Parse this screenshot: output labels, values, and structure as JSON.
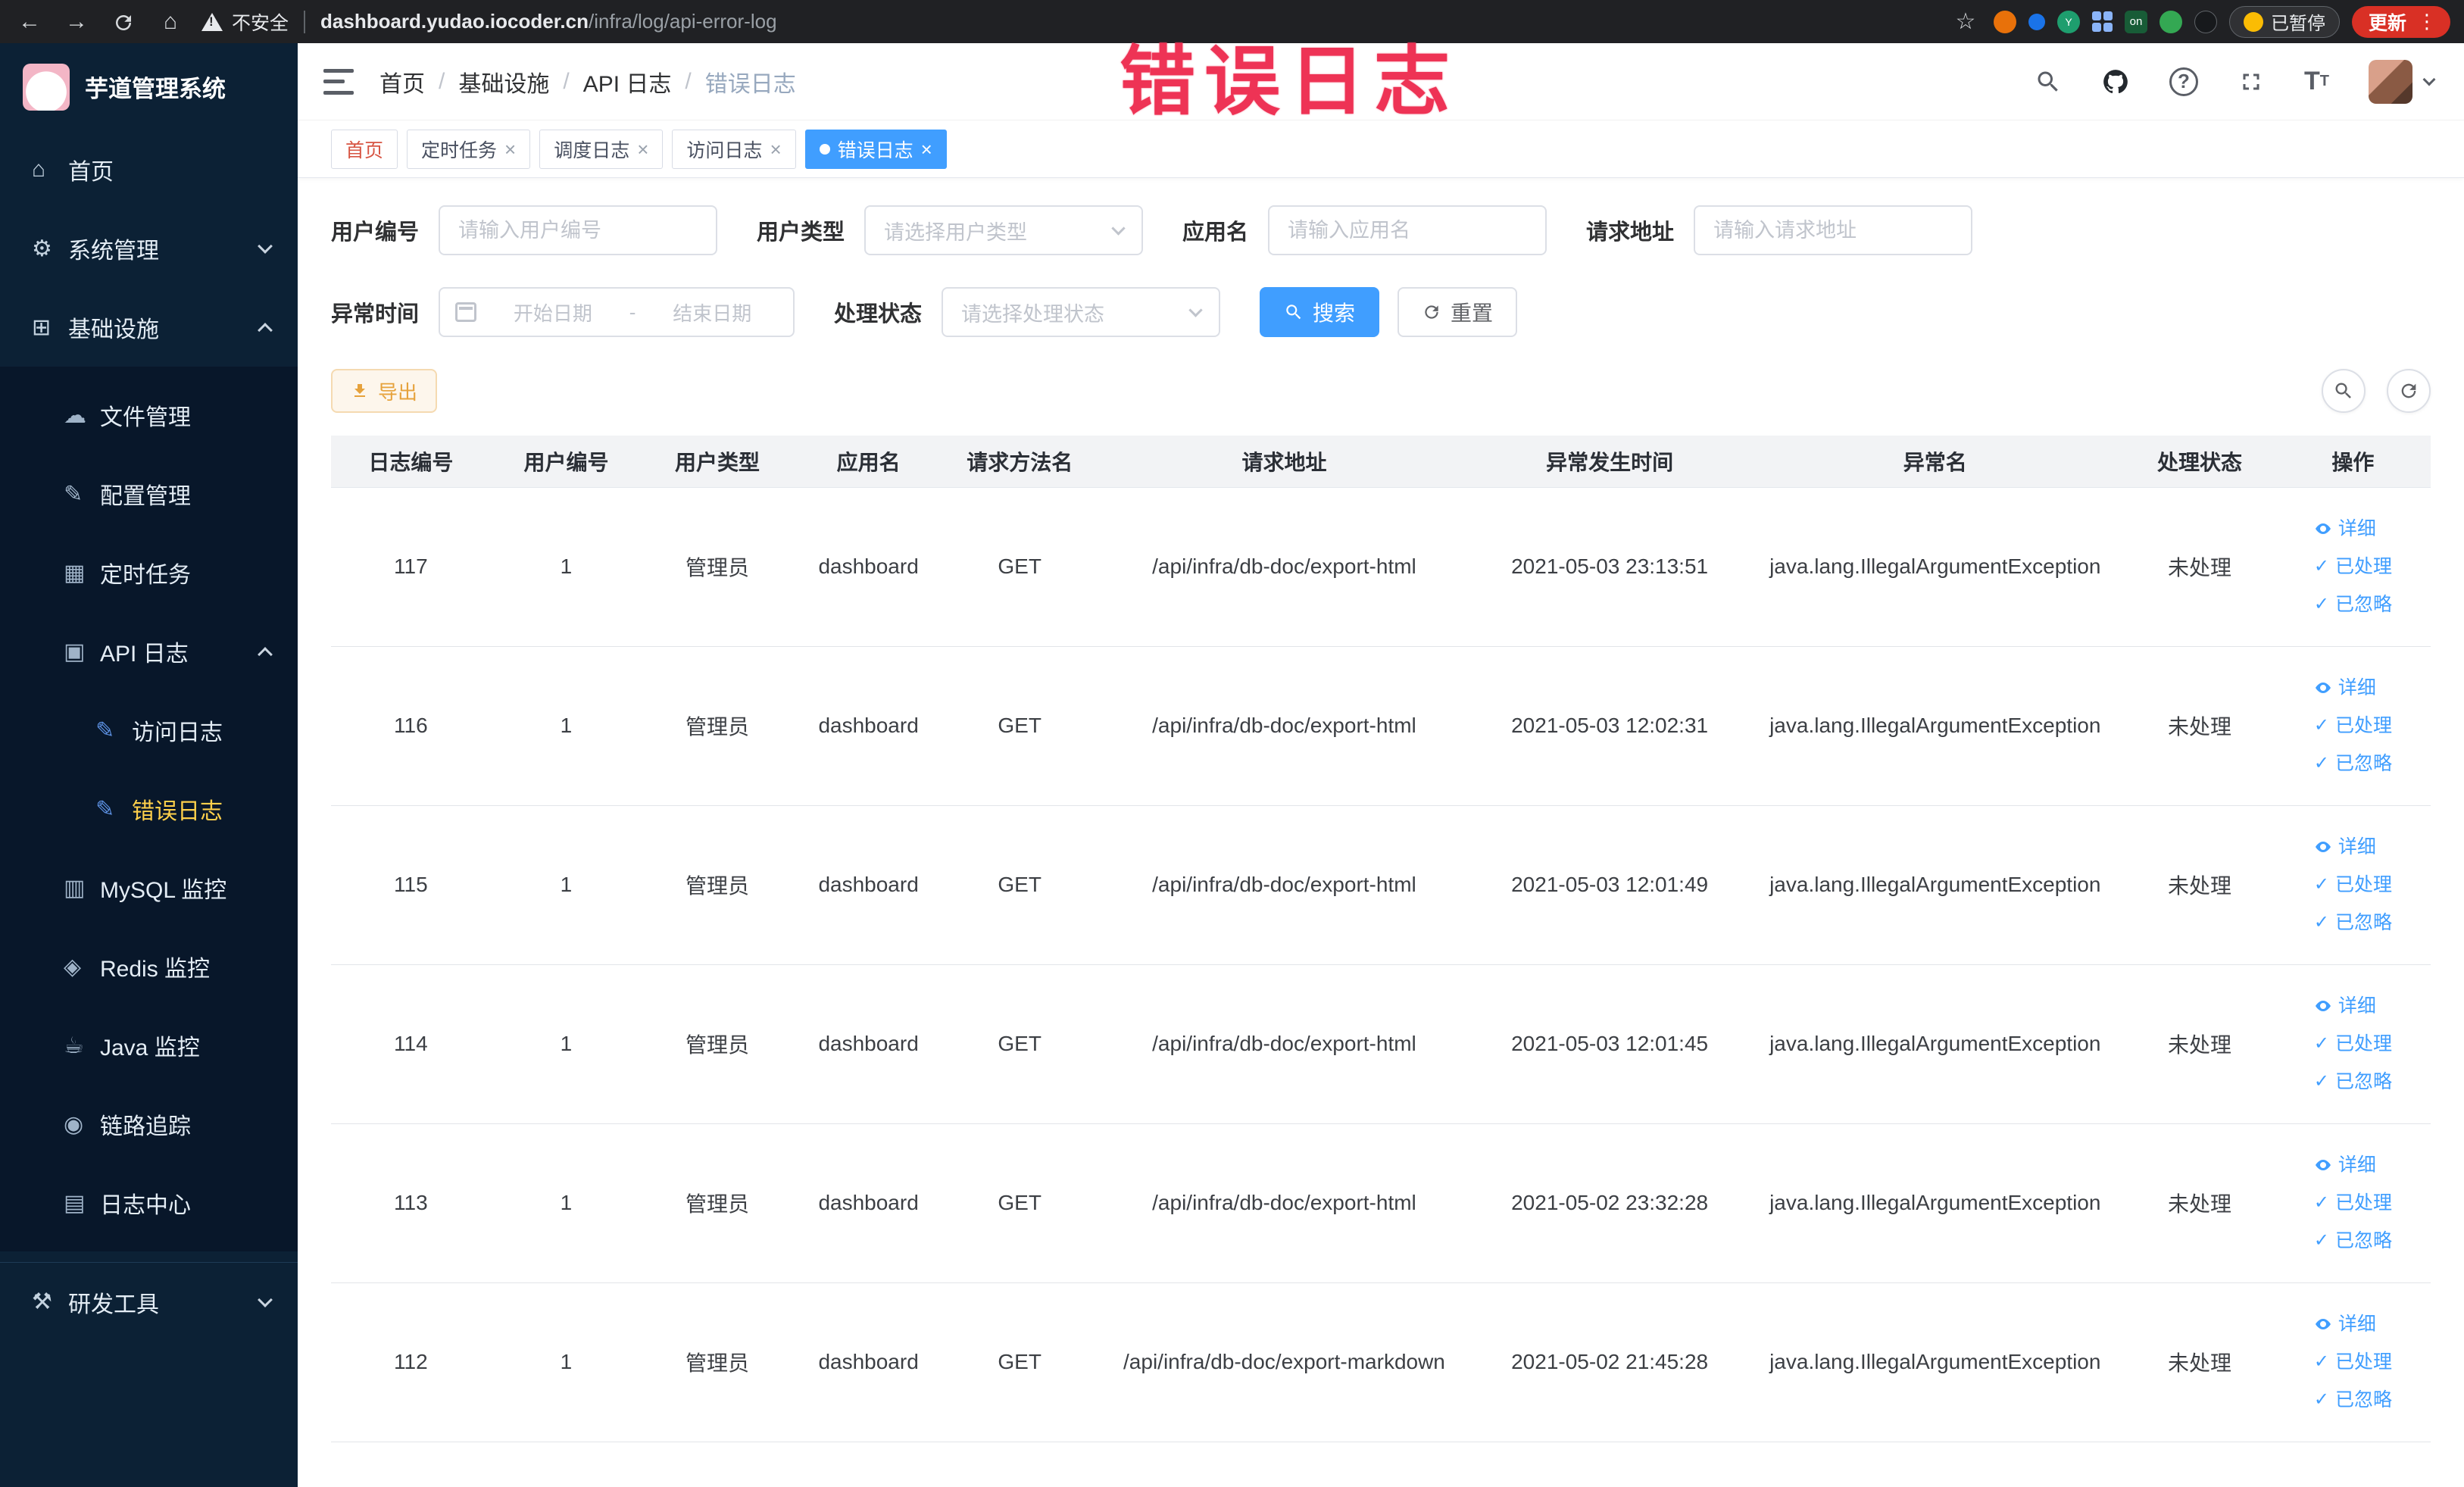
{
  "browser": {
    "security_label": "不安全",
    "url_host": "dashboard.yudao.iocoder.cn",
    "url_path": "/infra/log/api-error-log",
    "ext_on_label": "on",
    "paused_badge": "已暂停",
    "update_label": "更新"
  },
  "icons": {
    "back": "←",
    "forward": "→",
    "home": "⌂",
    "star": "☆",
    "close": "×",
    "check": "✓",
    "question": "?",
    "breadcrumb_sep": "/",
    "menu_dots": "⋮"
  },
  "watermark": "错误日志",
  "sidebar": {
    "logo_title": "芋道管理系统",
    "items": [
      {
        "label": "首页",
        "glyph": "⌂"
      },
      {
        "label": "系统管理",
        "glyph": "⚙"
      },
      {
        "label": "基础设施",
        "glyph": "⊞"
      },
      {
        "label": "文件管理",
        "glyph": "☁"
      },
      {
        "label": "配置管理",
        "glyph": "✎"
      },
      {
        "label": "定时任务",
        "glyph": "▦"
      },
      {
        "label": "API 日志",
        "glyph": "▣"
      },
      {
        "label": "访问日志",
        "glyph": "✎"
      },
      {
        "label": "错误日志",
        "glyph": "✎"
      },
      {
        "label": "MySQL 监控",
        "glyph": "▥"
      },
      {
        "label": "Redis 监控",
        "glyph": "◈"
      },
      {
        "label": "Java 监控",
        "glyph": "☕"
      },
      {
        "label": "链路追踪",
        "glyph": "◉"
      },
      {
        "label": "日志中心",
        "glyph": "▤"
      },
      {
        "label": "研发工具",
        "glyph": "⚒"
      }
    ]
  },
  "header": {
    "breadcrumbs": [
      "首页",
      "基础设施",
      "API 日志",
      "错误日志"
    ]
  },
  "tabs": [
    {
      "label": "首页"
    },
    {
      "label": "定时任务"
    },
    {
      "label": "调度日志"
    },
    {
      "label": "访问日志"
    },
    {
      "label": "错误日志"
    }
  ],
  "filters": {
    "user_id_label": "用户编号",
    "user_id_placeholder": "请输入用户编号",
    "user_type_label": "用户类型",
    "user_type_placeholder": "请选择用户类型",
    "app_name_label": "应用名",
    "app_name_placeholder": "请输入应用名",
    "request_url_label": "请求地址",
    "request_url_placeholder": "请输入请求地址",
    "time_label": "异常时间",
    "time_start_placeholder": "开始日期",
    "time_separator": "-",
    "time_end_placeholder": "结束日期",
    "status_label": "处理状态",
    "status_placeholder": "请选择处理状态",
    "search_label": "搜索",
    "reset_label": "重置"
  },
  "toolbar": {
    "export_label": "导出"
  },
  "table": {
    "columns": [
      "日志编号",
      "用户编号",
      "用户类型",
      "应用名",
      "请求方法名",
      "请求地址",
      "异常发生时间",
      "异常名",
      "处理状态",
      "操作"
    ],
    "actions": {
      "detail": "详细",
      "processed": "已处理",
      "ignored": "已忽略"
    },
    "rows": [
      {
        "id": "117",
        "user_id": "1",
        "user_type": "管理员",
        "app": "dashboard",
        "method": "GET",
        "url": "/api/infra/db-doc/export-html",
        "time": "2021-05-03 23:13:51",
        "exception": "java.lang.IllegalArgumentException",
        "status": "未处理"
      },
      {
        "id": "116",
        "user_id": "1",
        "user_type": "管理员",
        "app": "dashboard",
        "method": "GET",
        "url": "/api/infra/db-doc/export-html",
        "time": "2021-05-03 12:02:31",
        "exception": "java.lang.IllegalArgumentException",
        "status": "未处理"
      },
      {
        "id": "115",
        "user_id": "1",
        "user_type": "管理员",
        "app": "dashboard",
        "method": "GET",
        "url": "/api/infra/db-doc/export-html",
        "time": "2021-05-03 12:01:49",
        "exception": "java.lang.IllegalArgumentException",
        "status": "未处理"
      },
      {
        "id": "114",
        "user_id": "1",
        "user_type": "管理员",
        "app": "dashboard",
        "method": "GET",
        "url": "/api/infra/db-doc/export-html",
        "time": "2021-05-03 12:01:45",
        "exception": "java.lang.IllegalArgumentException",
        "status": "未处理"
      },
      {
        "id": "113",
        "user_id": "1",
        "user_type": "管理员",
        "app": "dashboard",
        "method": "GET",
        "url": "/api/infra/db-doc/export-html",
        "time": "2021-05-02 23:32:28",
        "exception": "java.lang.IllegalArgumentException",
        "status": "未处理"
      },
      {
        "id": "112",
        "user_id": "1",
        "user_type": "管理员",
        "app": "dashboard",
        "method": "GET",
        "url": "/api/infra/db-doc/export-markdown",
        "time": "2021-05-02 21:45:28",
        "exception": "java.lang.IllegalArgumentException",
        "status": "未处理"
      }
    ]
  },
  "colors": {
    "primary": "#409eff",
    "sidebar_bg": "#0c2135",
    "active_menu_text": "#ffd04b",
    "warning": "#e6a23c",
    "watermark": "#ee3355"
  }
}
